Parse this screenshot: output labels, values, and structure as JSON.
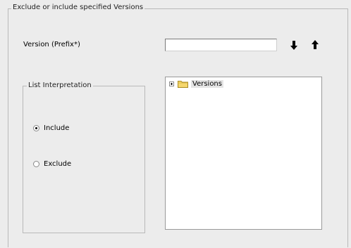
{
  "group": {
    "title": "Exclude or include specified Versions"
  },
  "version": {
    "label": "Version (Prefix*)",
    "value": "",
    "placeholder": ""
  },
  "buttons": {
    "down_icon": "arrow-down-icon",
    "up_icon": "arrow-up-icon"
  },
  "interpretation": {
    "title": "List Interpretation",
    "options": [
      {
        "label": "Include",
        "checked": true
      },
      {
        "label": "Exclude",
        "checked": false
      }
    ]
  },
  "tree": {
    "root": {
      "label": "Versions",
      "expanded": false,
      "icon": "folder-icon"
    }
  },
  "colors": {
    "background": "#ececec",
    "border": "#b9b9b9",
    "folder": "#f5d76e"
  }
}
